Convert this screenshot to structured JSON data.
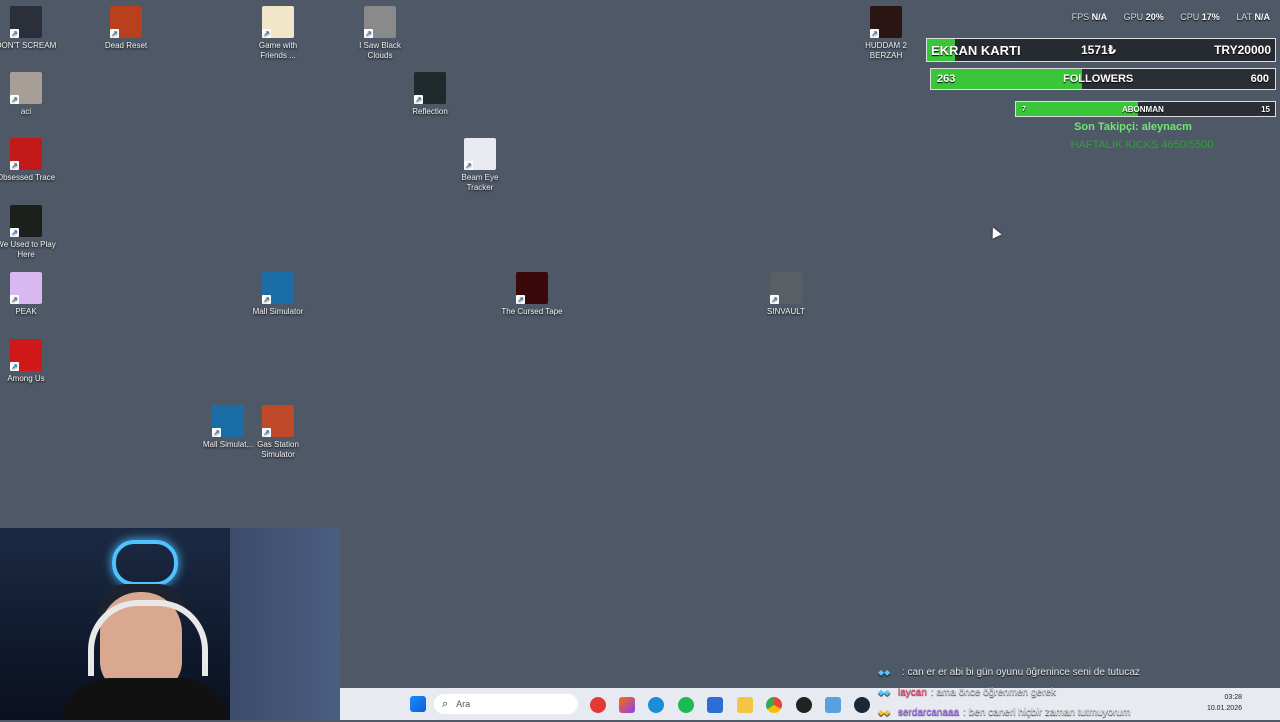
{
  "desktop": {
    "icons": [
      {
        "label": "DON'T SCREAM",
        "color": "#2a2f3a"
      },
      {
        "label": "Dead Reset",
        "color": "#b8401e"
      },
      {
        "label": "Game with Friends ...",
        "color": "#f1e7c8"
      },
      {
        "label": "I Saw Black Clouds",
        "color": "#8a8a8a"
      },
      {
        "label": "HUDDAM 2 BERZAH",
        "color": "#2a1414"
      },
      {
        "label": "aci",
        "color": "#a79e97"
      },
      {
        "label": "Reflection",
        "color": "#1f2a2c"
      },
      {
        "label": "Beam Eye Tracker",
        "color": "#eaeaf3"
      },
      {
        "label": "Obsessed Trace",
        "color": "#c21a1a"
      },
      {
        "label": "We Used to Play Here",
        "color": "#1d1f1d"
      },
      {
        "label": "PEAK",
        "color": "#d9b7f0"
      },
      {
        "label": "Mall Simulator",
        "color": "#1b6da8"
      },
      {
        "label": "The Cursed Tape",
        "color": "#3a0a0a"
      },
      {
        "label": "SINVAULT",
        "color": "#5a5f66"
      },
      {
        "label": "Among Us",
        "color": "#d01818"
      },
      {
        "label": "Mall Simulat...",
        "color": "#1b6da8"
      },
      {
        "label": "Gas Station Simulator",
        "color": "#c0492a"
      }
    ]
  },
  "overlay": {
    "stats": {
      "fps_label": "FPS",
      "fps_value": "N/A",
      "gpu_label": "GPU",
      "gpu_value": "20%",
      "cpu_label": "CPU",
      "cpu_value": "17%",
      "lat_label": "LAT",
      "lat_value": "N/A"
    },
    "ekran": {
      "label": "EKRAN KARTI",
      "current": "1571₺",
      "target": "TRY20000",
      "progress": 0.08
    },
    "followers": {
      "label": "FOLLOWERS",
      "current": "263",
      "target": "600",
      "progress": 0.44
    },
    "abonman": {
      "label": "ABONMAN",
      "current": "7",
      "target": "15",
      "progress": 0.47
    },
    "last_follower": "Son Takipçi: aleynacm",
    "weekly_kicks": "HAFTALIK KICKS 4650/5500",
    "accent": "#39c739"
  },
  "chat": [
    {
      "user": "",
      "text": ": can er er abi bi gün oyunu öğrenince seni de tutucaz"
    },
    {
      "user": "laycan",
      "text": ": ama önce öğrenmen gerek"
    },
    {
      "user": "serdarcanaaa",
      "text": ": ben caneri hiçbir zaman tutmuyorum"
    }
  ],
  "taskbar": {
    "search_placeholder": "Ara",
    "time": "03:28",
    "date": "10.01.2026"
  }
}
